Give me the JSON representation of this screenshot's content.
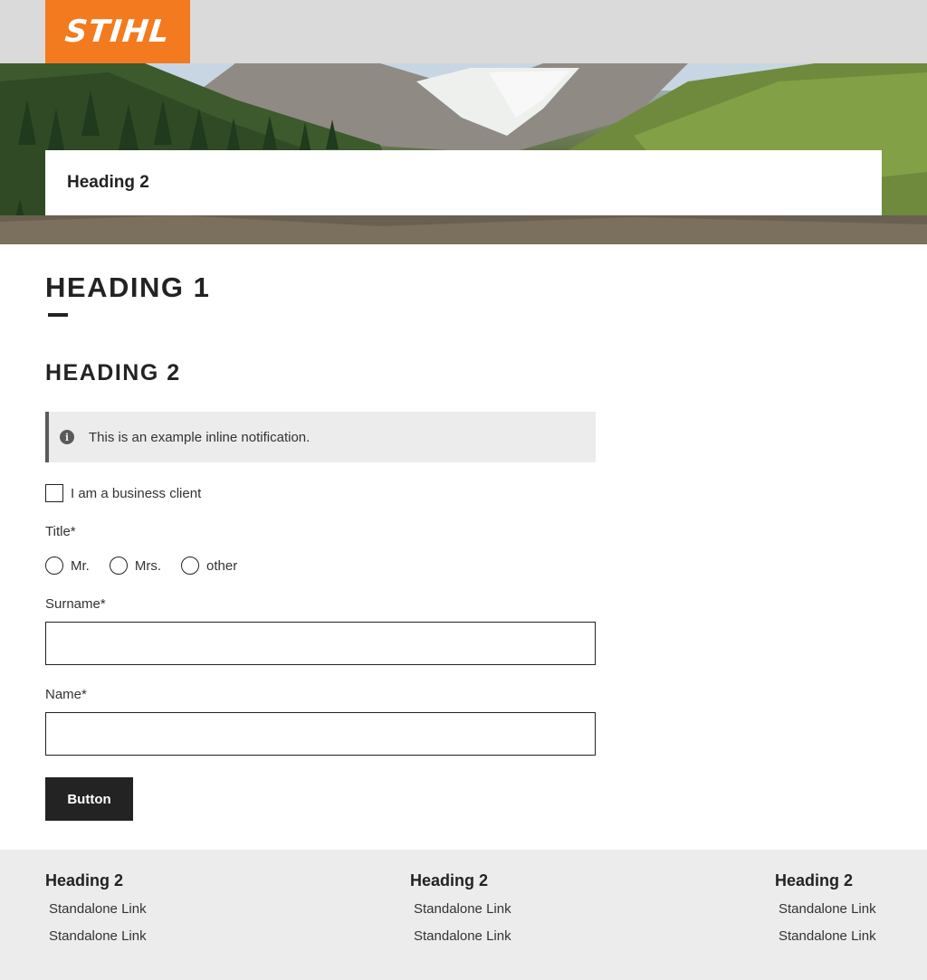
{
  "header": {
    "logo_text": "STIHL",
    "brand_color": "#f37a1f",
    "bar_color": "#dadada"
  },
  "hero": {
    "card_heading": "Heading 2"
  },
  "main": {
    "heading1": "HEADING 1",
    "heading2": "HEADING 2",
    "notification": {
      "icon": "info-icon",
      "text": "This is an example inline notification."
    },
    "business_checkbox": {
      "label": "I am a business client",
      "checked": false
    },
    "title_field": {
      "label": "Title*",
      "options": [
        "Mr.",
        "Mrs.",
        "other"
      ],
      "selected": null
    },
    "surname_field": {
      "label": "Surname*",
      "value": ""
    },
    "name_field": {
      "label": "Name*",
      "value": ""
    },
    "button_label": "Button"
  },
  "footer": {
    "columns": [
      {
        "heading": "Heading 2",
        "links": [
          "Standalone Link",
          "Standalone Link"
        ]
      },
      {
        "heading": "Heading 2",
        "links": [
          "Standalone Link",
          "Standalone Link"
        ]
      },
      {
        "heading": "Heading 2",
        "links": [
          "Standalone Link",
          "Standalone Link"
        ]
      }
    ]
  }
}
